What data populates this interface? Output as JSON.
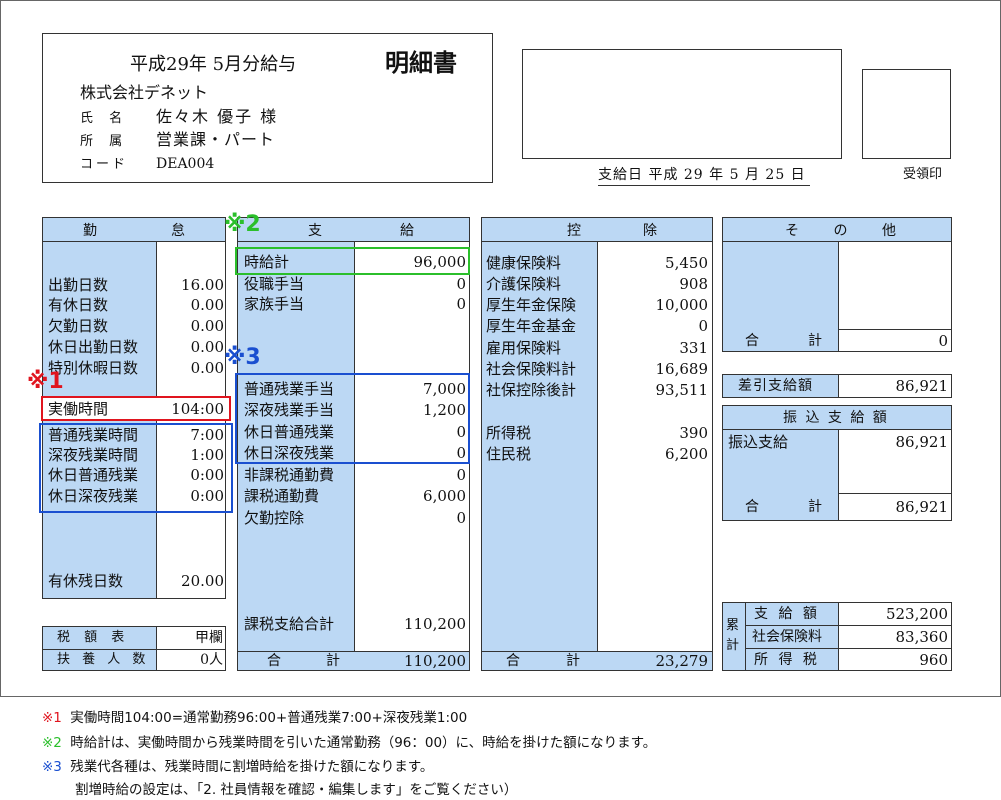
{
  "header": {
    "period": "平成29年 5月分給与",
    "doc_title": "明細書",
    "company": "株式会社デネット",
    "name_label": "氏 名",
    "name": "佐々木 優子 様",
    "dept_label": "所 属",
    "dept": "営業課・パート",
    "code_label": "コード",
    "code": "DEA004",
    "payday": "支給日 平成 29 年 5 月 25 日",
    "receipt_label": "受領印"
  },
  "attendance": {
    "header": [
      "勤",
      "怠"
    ],
    "rows": [
      {
        "label": "出勤日数",
        "value": "16.00"
      },
      {
        "label": "有休日数",
        "value": "0.00"
      },
      {
        "label": "欠勤日数",
        "value": "0.00"
      },
      {
        "label": "休日出勤日数",
        "value": "0.00"
      },
      {
        "label": "特別休暇日数",
        "value": "0.00"
      },
      {
        "label": "実働時間",
        "value": "104:00"
      },
      {
        "label": "普通残業時間",
        "value": "7:00"
      },
      {
        "label": "深夜残業時間",
        "value": "1:00"
      },
      {
        "label": "休日普通残業",
        "value": "0:00"
      },
      {
        "label": "休日深夜残業",
        "value": "0:00"
      },
      {
        "label": "有休残日数",
        "value": "20.00"
      }
    ],
    "tax_table_label": "税 額 表",
    "tax_table_value": "甲欄",
    "dependents_label": "扶 養 人 数",
    "dependents_value": "0人"
  },
  "payment": {
    "header": [
      "支",
      "給"
    ],
    "rows": [
      {
        "label": "時給計",
        "value": "96,000"
      },
      {
        "label": "役職手当",
        "value": "0"
      },
      {
        "label": "家族手当",
        "value": "0"
      },
      {
        "label": "普通残業手当",
        "value": "7,000"
      },
      {
        "label": "深夜残業手当",
        "value": "1,200"
      },
      {
        "label": "休日普通残業",
        "value": "0"
      },
      {
        "label": "休日深夜残業",
        "value": "0"
      },
      {
        "label": "非課税通勤費",
        "value": "0"
      },
      {
        "label": "課税通勤費",
        "value": "6,000"
      },
      {
        "label": "欠勤控除",
        "value": "0"
      }
    ],
    "taxable_total_label": "課税支給合計",
    "taxable_total": "110,200",
    "total_label": [
      "合",
      "計"
    ],
    "total": "110,200"
  },
  "deduction": {
    "header": [
      "控",
      "除"
    ],
    "rows": [
      {
        "label": "健康保険料",
        "value": "5,450"
      },
      {
        "label": "介護保険料",
        "value": "908"
      },
      {
        "label": "厚生年金保険",
        "value": "10,000"
      },
      {
        "label": "厚生年金基金",
        "value": "0"
      },
      {
        "label": "雇用保険料",
        "value": "331"
      },
      {
        "label": "社会保険料計",
        "value": "16,689"
      },
      {
        "label": "社保控除後計",
        "value": "93,511"
      },
      {
        "label": "所得税",
        "value": "390"
      },
      {
        "label": "住民税",
        "value": "6,200"
      }
    ],
    "total_label": [
      "合",
      "計"
    ],
    "total": "23,279"
  },
  "other": {
    "header": [
      "そ",
      "の",
      "他"
    ],
    "total_label": [
      "合",
      "計"
    ],
    "total": "0",
    "net_pay_label": "差引支給額",
    "net_pay": "86,921",
    "transfer_header": "振 込 支 給 額",
    "transfer_label": "振込支給",
    "transfer_value": "86,921",
    "transfer_total_label": [
      "合",
      "計"
    ],
    "transfer_total": "86,921"
  },
  "cumulative": {
    "label": "累計",
    "rows": [
      {
        "label": "支 給 額",
        "value": "523,200"
      },
      {
        "label": "社会保険料",
        "value": "83,360"
      },
      {
        "label": "所 得 税",
        "value": "960"
      }
    ]
  },
  "markers": {
    "m1": "※1",
    "m2": "※2",
    "m3": "※3"
  },
  "colors": {
    "m1": "#e0141e",
    "m2": "#2bbf2b",
    "m3": "#1a4fd0"
  },
  "notes": [
    {
      "mark": "※1",
      "text": "実働時間104:00=通常勤務96:00+普通残業7:00+深夜残業1:00"
    },
    {
      "mark": "※2",
      "text": "時給計は、実働時間から残業時間を引いた通常勤務（96：00）に、時給を掛けた額になります。"
    },
    {
      "mark": "※3",
      "text": "残業代各種は、残業時間に割増時給を掛けた額になります。"
    },
    {
      "mark": "",
      "text": "割増時給の設定は、「2. 社員情報を確認・編集します」をご覧ください）"
    }
  ]
}
